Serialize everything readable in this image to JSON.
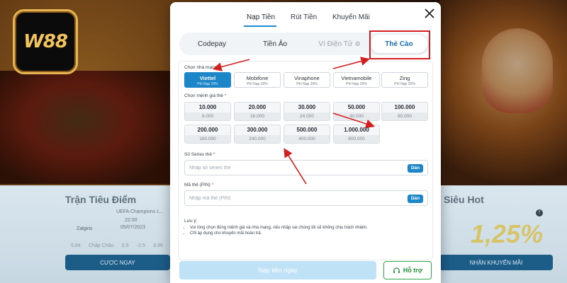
{
  "background": {
    "logo_text": "W88",
    "left_card": {
      "title": "Trận Tiêu Điểm",
      "league": "UEFA Champions L..",
      "time": "22:00",
      "date": "05/07/2023",
      "team": "Zalgiris",
      "odds": [
        "5.84",
        "Chấp Châu",
        "0.5",
        "-2.5",
        "8.96"
      ],
      "button": "CƯỢC NGAY"
    },
    "right_card": {
      "title": "Siêu Hot",
      "percent": "1,25%",
      "info": "!",
      "button": "NHẬN KHUYẾN MÃI"
    }
  },
  "modal": {
    "top_tabs": [
      {
        "label": "Nạp Tiền",
        "active": true
      },
      {
        "label": "Rút Tiền",
        "active": false
      },
      {
        "label": "Khuyến Mãi",
        "active": false
      }
    ],
    "close_icon": "close-icon",
    "methods": [
      {
        "label": "Codepay",
        "state": "normal"
      },
      {
        "label": "Tiền Ảo",
        "state": "normal"
      },
      {
        "label": "Ví Điện Tử",
        "state": "disabled",
        "icon": "gear-icon"
      },
      {
        "label": "Thẻ Cào",
        "state": "active"
      }
    ],
    "network_label": "Chọn nhà mạng",
    "networks": [
      {
        "name": "Viettel",
        "fee": "Phí Nạp 20%",
        "active": true
      },
      {
        "name": "Mobifone",
        "fee": "Phí Nạp 20%",
        "active": false
      },
      {
        "name": "Vinaphone",
        "fee": "Phí Nạp 20%",
        "active": false
      },
      {
        "name": "Vietnamobile",
        "fee": "Phí Nạp 20%",
        "active": false
      },
      {
        "name": "Zing",
        "fee": "Phí Nạp 20%",
        "active": false
      }
    ],
    "denom_label": "Chọn mệnh giá thẻ",
    "denominations": [
      {
        "value": "10.000",
        "receive": "8.000"
      },
      {
        "value": "20.000",
        "receive": "16.000"
      },
      {
        "value": "30.000",
        "receive": "24.000"
      },
      {
        "value": "50.000",
        "receive": "40.000"
      },
      {
        "value": "100.000",
        "receive": "80.000"
      },
      {
        "value": "200.000",
        "receive": "160.000"
      },
      {
        "value": "300.000",
        "receive": "240.000"
      },
      {
        "value": "500.000",
        "receive": "400.000"
      },
      {
        "value": "1.000.000",
        "receive": "800.000"
      }
    ],
    "serial": {
      "label": "Số Series thẻ",
      "placeholder": "Nhập số series thẻ",
      "value": "",
      "paste": "Dán"
    },
    "pin": {
      "label": "Mã thẻ (PIN)",
      "placeholder": "Nhập mã thẻ (PIN)",
      "value": "",
      "paste": "Dán"
    },
    "notes_title": "Lưu ý:",
    "notes": [
      "Vui lòng chọn đúng mệnh giá và nhà mạng, nếu nhập sai chúng tôi sẽ không chịu trách nhiệm.",
      "Chỉ áp dụng cho khuyến mãi hoàn trả."
    ],
    "submit": "Nạp tiền ngay",
    "support": "Hỗ trợ",
    "support_icon": "headset-icon"
  },
  "colors": {
    "accent": "#1d86c9",
    "highlight": "#d21e1e",
    "support": "#2ea84a"
  }
}
